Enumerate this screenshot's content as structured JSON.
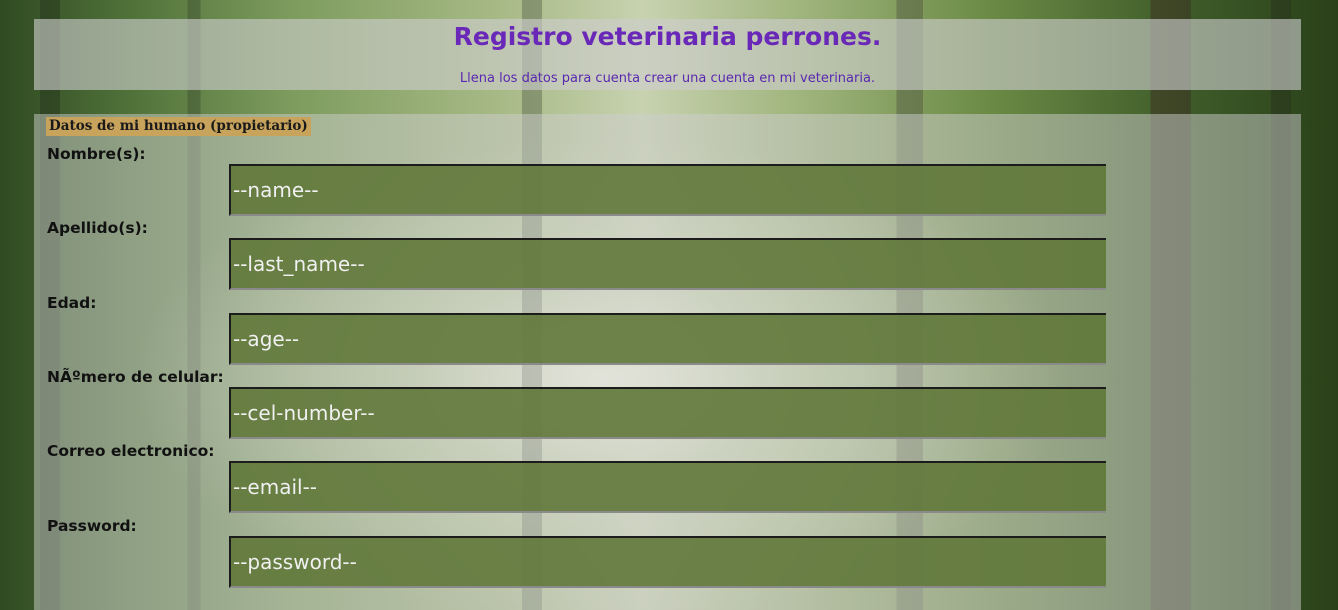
{
  "header": {
    "title": "Registro veterinaria perrones.",
    "subtitle": "Llena los datos para cuenta crear una cuenta en mi veterinaria."
  },
  "form": {
    "legend": "Datos de mi humano (propietario)",
    "fields": [
      {
        "label": "Nombre(s):",
        "placeholder": "--name--",
        "value": ""
      },
      {
        "label": "Apellido(s):",
        "placeholder": "--last_name--",
        "value": ""
      },
      {
        "label": "Edad:",
        "placeholder": "--age--",
        "value": ""
      },
      {
        "label": "NÃºmero de celular:",
        "placeholder": "--cel-number--",
        "value": ""
      },
      {
        "label": "Correo electronico:",
        "placeholder": "--email--",
        "value": ""
      },
      {
        "label": "Password:",
        "placeholder": "--password--",
        "value": ""
      }
    ]
  },
  "colors": {
    "title": "#6a28b8",
    "legend_background": "#c7a35c",
    "input_background": "#60783a"
  }
}
